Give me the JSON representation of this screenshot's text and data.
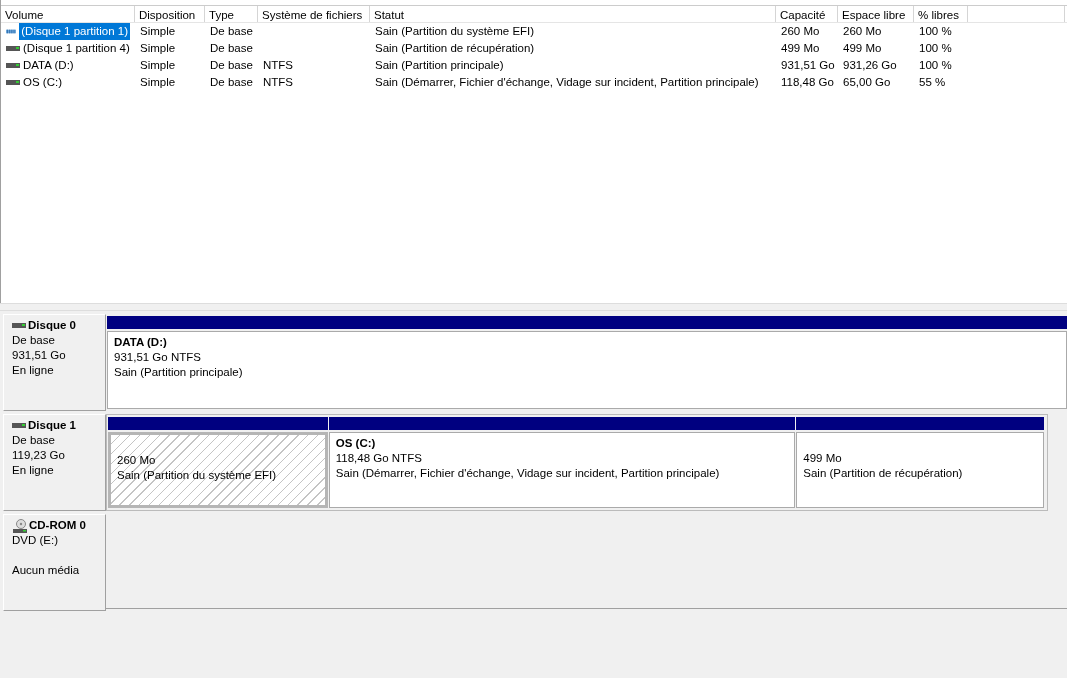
{
  "volume_table": {
    "columns": [
      "Volume",
      "Disposition",
      "Type",
      "Système de fichiers",
      "Statut",
      "Capacité",
      "Espace libre",
      "% libres"
    ],
    "rows": [
      {
        "selected": true,
        "cells": [
          "(Disque 1 partition 1)",
          "Simple",
          "De base",
          "",
          "Sain (Partition du système EFI)",
          "260 Mo",
          "260 Mo",
          "100 %"
        ]
      },
      {
        "selected": false,
        "cells": [
          "(Disque 1 partition 4)",
          "Simple",
          "De base",
          "",
          "Sain (Partition de récupération)",
          "499 Mo",
          "499 Mo",
          "100 %"
        ]
      },
      {
        "selected": false,
        "cells": [
          "DATA (D:)",
          "Simple",
          "De base",
          "NTFS",
          "Sain (Partition principale)",
          "931,51 Go",
          "931,26 Go",
          "100 %"
        ]
      },
      {
        "selected": false,
        "cells": [
          "OS (C:)",
          "Simple",
          "De base",
          "NTFS",
          "Sain (Démarrer, Fichier d'échange, Vidage sur incident, Partition principale)",
          "118,48 Go",
          "65,00 Go",
          "55 %"
        ]
      }
    ]
  },
  "disks": [
    {
      "kind": "disk",
      "name": "Disque 0",
      "lines": [
        "De base",
        "931,51 Go",
        "En ligne"
      ],
      "partitions": [
        {
          "selected": false,
          "name": "DATA  (D:)",
          "size": "931,51 Go NTFS",
          "status": "Sain (Partition principale)"
        }
      ]
    },
    {
      "kind": "disk",
      "name": "Disque 1",
      "lines": [
        "De base",
        "119,23 Go",
        "En ligne"
      ],
      "partitions": [
        {
          "selected": true,
          "size": "260 Mo",
          "status": "Sain (Partition du système EFI)"
        },
        {
          "selected": false,
          "name": "OS  (C:)",
          "size": "118,48 Go NTFS",
          "status": "Sain (Démarrer, Fichier d'échange, Vidage sur incident, Partition principale)"
        },
        {
          "selected": false,
          "size": "499 Mo",
          "status": "Sain (Partition de récupération)"
        }
      ]
    },
    {
      "kind": "cdrom",
      "name": "CD-ROM 0",
      "lines": [
        "DVD (E:)",
        "Aucun média"
      ]
    }
  ]
}
